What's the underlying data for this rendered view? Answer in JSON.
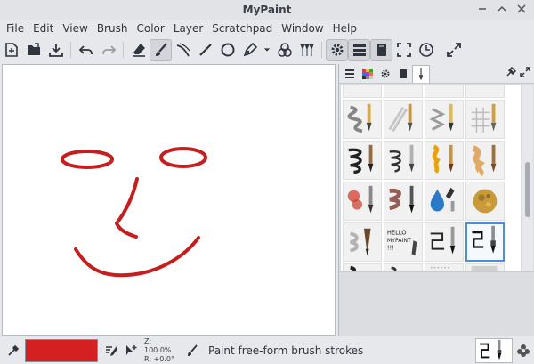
{
  "window": {
    "title": "MyPaint"
  },
  "menu": [
    "File",
    "Edit",
    "View",
    "Brush",
    "Color",
    "Layer",
    "Scratchpad",
    "Window",
    "Help"
  ],
  "status": {
    "zoom_text": "Z: 100.0%",
    "rotation_text": "R: +0.0°",
    "message": "Paint free-form brush strokes"
  },
  "colors": {
    "brush": "#d42020",
    "stroke": "#c41e1e",
    "selection": "#4a90d9"
  },
  "brush_preview_text": [
    "HELLO",
    "MYPAINT",
    "!!!"
  ]
}
